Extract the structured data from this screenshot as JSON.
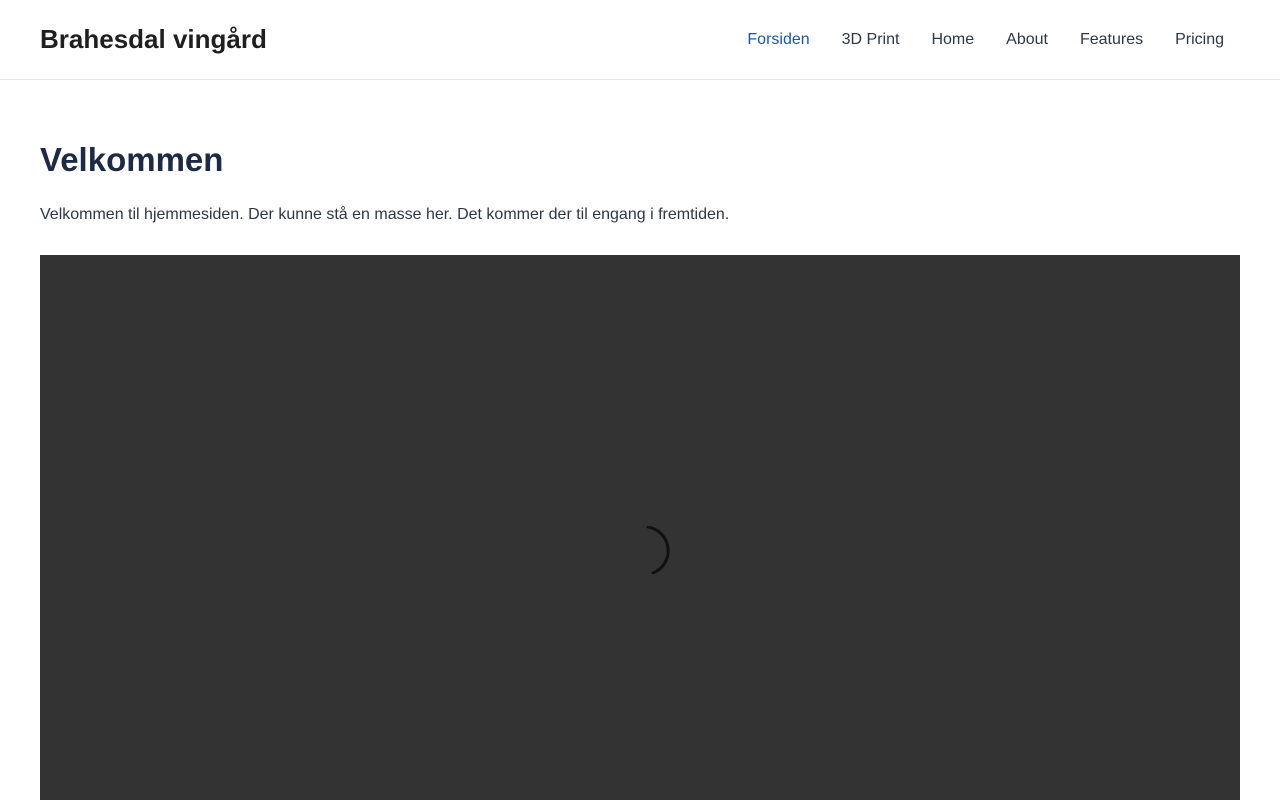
{
  "header": {
    "brand": "Brahesdal vingård",
    "nav": [
      {
        "label": "Forsiden",
        "active": true
      },
      {
        "label": "3D Print",
        "active": false
      },
      {
        "label": "Home",
        "active": false
      },
      {
        "label": "About",
        "active": false
      },
      {
        "label": "Features",
        "active": false
      },
      {
        "label": "Pricing",
        "active": false
      }
    ]
  },
  "main": {
    "title": "Velkommen",
    "intro": "Velkommen til hjemmesiden. Der kunne stå en masse her. Det kommer der til engang i fremtiden.",
    "media": {
      "state": "loading",
      "spinner_icon": "loading-spinner-icon"
    }
  },
  "colors": {
    "accent": "#1a56a6",
    "heading": "#1e2a45",
    "text": "#2d3748",
    "media_background": "#333333",
    "divider": "#e5e7eb"
  }
}
